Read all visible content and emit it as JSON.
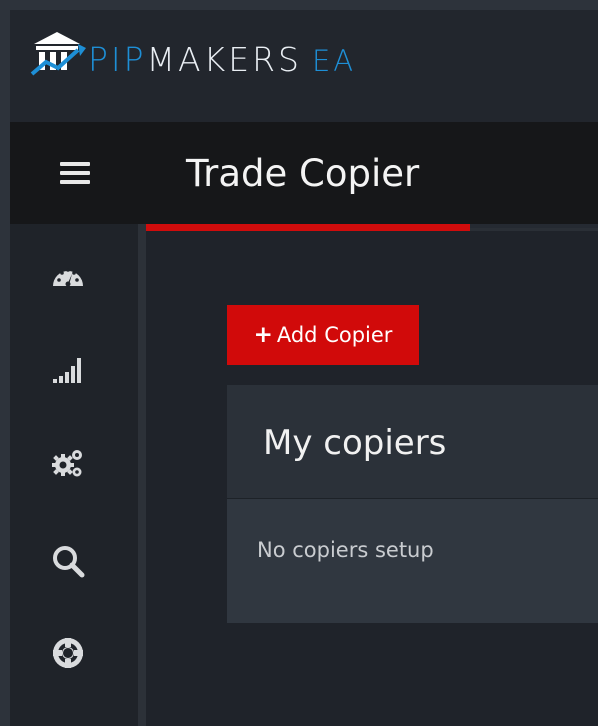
{
  "brand": {
    "logo_pip": "PIP",
    "logo_makers": "MAKERS",
    "logo_ea": "EA"
  },
  "header": {
    "page_title": "Trade Copier"
  },
  "sidebar": {
    "items": [
      {
        "icon": "dashboard-gauge-icon"
      },
      {
        "icon": "signal-bars-icon"
      },
      {
        "icon": "gears-icon"
      },
      {
        "icon": "search-icon"
      },
      {
        "icon": "lifebuoy-icon"
      }
    ]
  },
  "main": {
    "add_button_label": "Add Copier",
    "add_button_plus": "+",
    "panel_title": "My copiers",
    "empty_message": "No copiers setup"
  },
  "colors": {
    "accent_red": "#d10a0a",
    "brand_blue": "#1e8fd6"
  }
}
